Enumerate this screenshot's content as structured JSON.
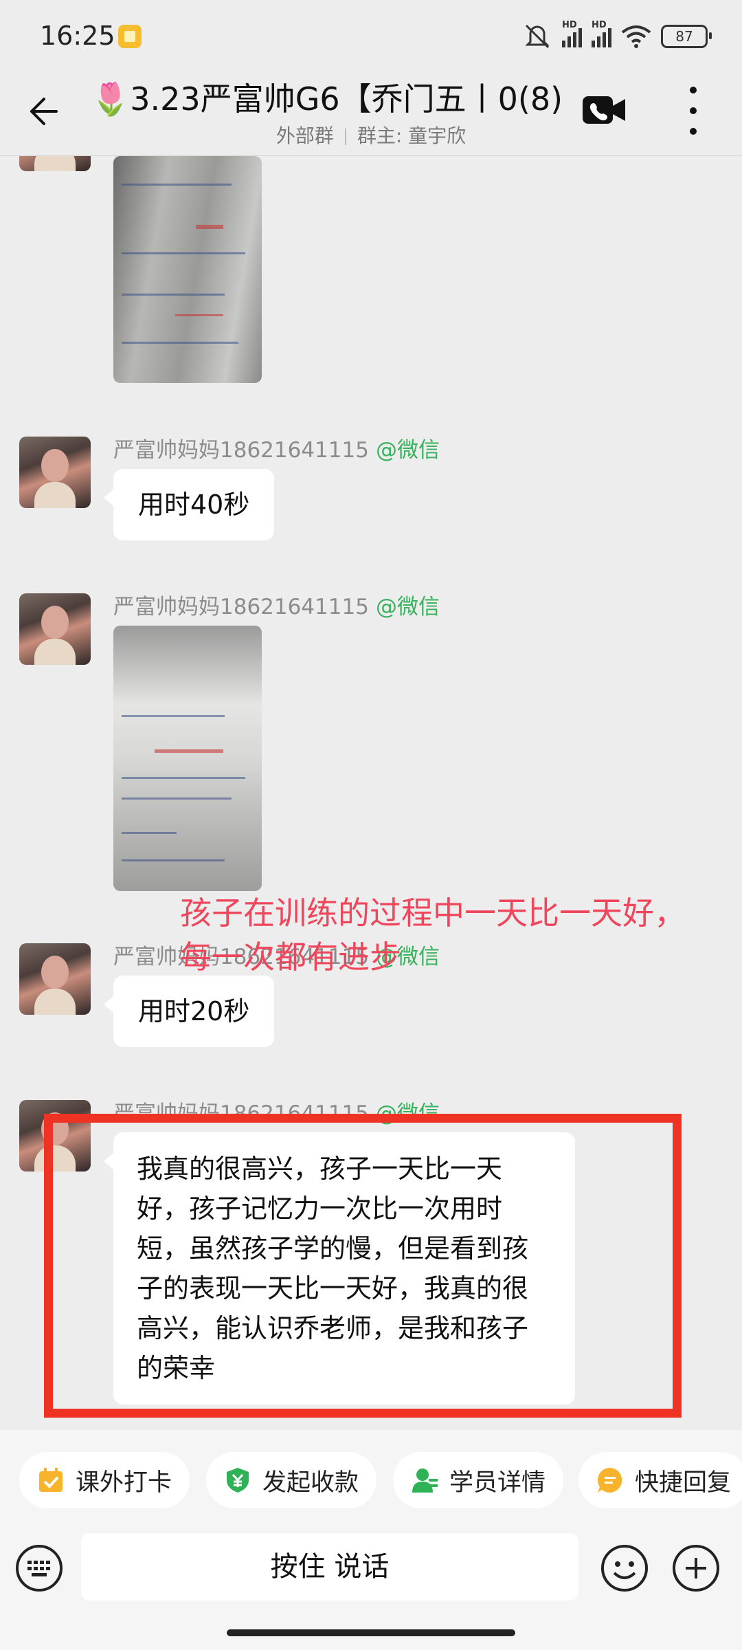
{
  "status_bar": {
    "time": "16:25",
    "battery": "87",
    "signal_label_1": "HD",
    "signal_label_2": "HD"
  },
  "header": {
    "title": "🌷3.23严富帅G6【乔门五丨0(8)",
    "group_type": "外部群",
    "owner": "群主: 童宇欣"
  },
  "messages": [
    {
      "type": "image",
      "sender": null
    },
    {
      "type": "text",
      "sender": "严富帅妈妈18621641115",
      "source": "@微信",
      "text": "用时40秒"
    },
    {
      "type": "image",
      "sender": "严富帅妈妈18621641115",
      "source": "@微信"
    },
    {
      "type": "text",
      "sender": "严富帅妈妈18621641115",
      "source": "@微信",
      "text": "用时20秒"
    },
    {
      "type": "text",
      "sender": "严富帅妈妈18621641115",
      "source": "@微信",
      "lines": [
        "我真的很高兴，孩子一天比一天",
        "好，孩子记忆力一次比一次用时",
        "短，虽然孩子学的慢，但是看到孩",
        "子的表现一天比一天好，我真的很",
        "高兴，能认识乔老师，是我和孩子",
        "的荣幸"
      ]
    }
  ],
  "annotation": {
    "line1": "孩子在训练的过程中一天比一天好，",
    "line2": "每一次都有进步",
    "color": "#f0465c",
    "box_color": "#ee3324"
  },
  "quick_actions": [
    {
      "label": "课外打卡",
      "icon": "calendar-check-icon"
    },
    {
      "label": "发起收款",
      "icon": "yuan-shield-icon"
    },
    {
      "label": "学员详情",
      "icon": "student-profile-icon"
    },
    {
      "label": "快捷回复",
      "icon": "quick-reply-icon"
    }
  ],
  "input": {
    "hold_to_talk": "按住 说话"
  }
}
